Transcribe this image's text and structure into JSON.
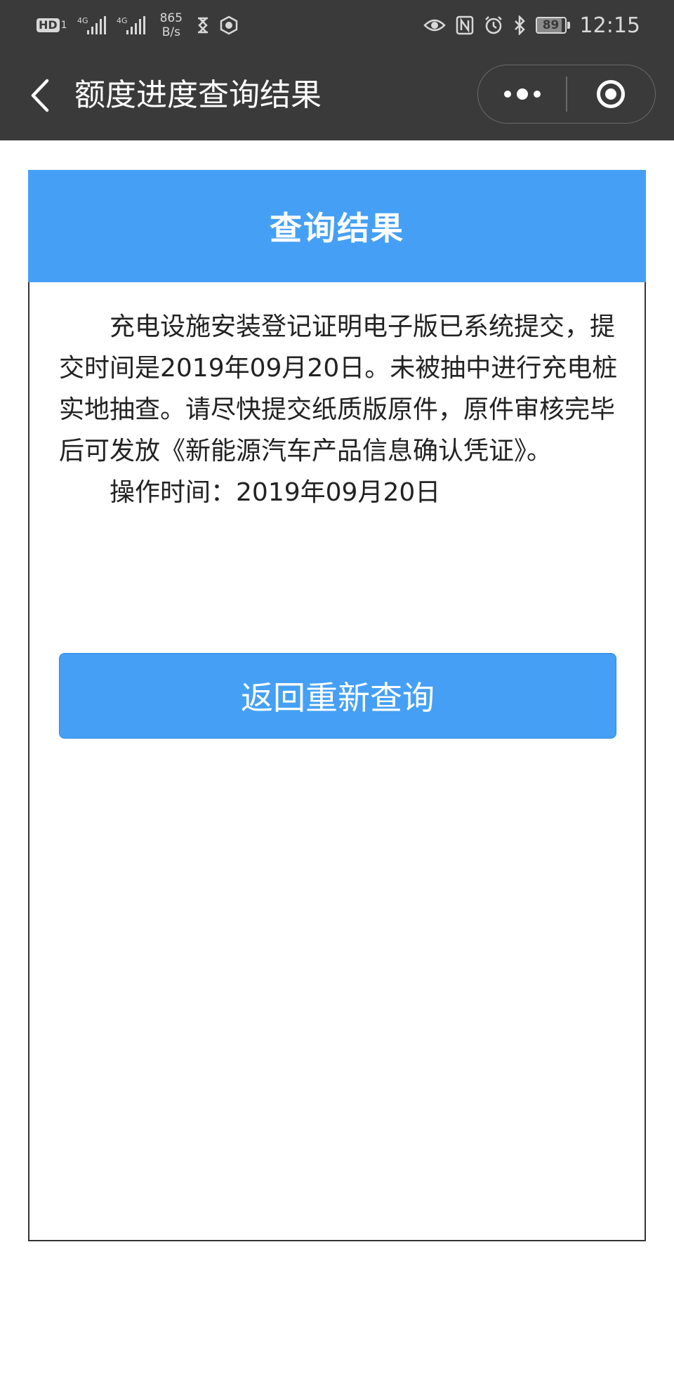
{
  "status_bar": {
    "hd_label": "HD",
    "hd_sub": "1",
    "signal1_label": "4G",
    "signal2_label": "4G",
    "net_speed_value": "865",
    "net_speed_unit": "B/s",
    "battery_level": "89",
    "battery_fraction": 0.89,
    "time": "12:15",
    "icons": [
      "hd-icon",
      "signal-icon",
      "signal-icon",
      "hourglass-icon",
      "shield-icon",
      "eye-icon",
      "nfc-icon",
      "alarm-icon",
      "bluetooth-icon",
      "battery-icon"
    ]
  },
  "nav": {
    "title": "额度进度查询结果",
    "back_icon": "chevron-left-icon",
    "more_icon": "more-dots-icon",
    "close_icon": "target-circle-icon"
  },
  "card": {
    "header_title": "查询结果",
    "message": "充电设施安装登记证明电子版已系统提交，提交时间是2019年09月20日。未被抽中进行充电桩实地抽查。请尽快提交纸质版原件，原件审核完毕后可发放《新能源汽车产品信息确认凭证》。",
    "op_time_label": "操作时间：",
    "op_time_value": "2019年09月20日",
    "requery_button": "返回重新查询"
  },
  "colors": {
    "status_bar_bg": "#3a3a3a",
    "header_blue": "#45a0f5",
    "button_blue": "#45a0f5",
    "text_dark": "#222222"
  }
}
